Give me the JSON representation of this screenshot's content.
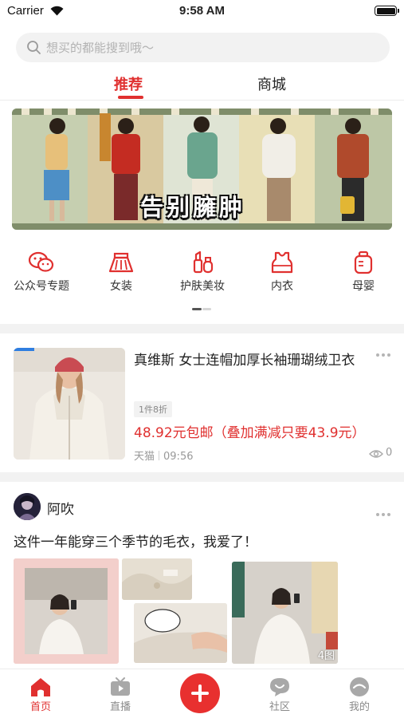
{
  "status_bar": {
    "carrier": "Carrier",
    "time": "9:58 AM"
  },
  "search": {
    "placeholder": "想买的都能搜到哦～"
  },
  "top_tabs": [
    {
      "label": "推荐",
      "active": true
    },
    {
      "label": "商城",
      "active": false
    }
  ],
  "banner": {
    "headline": "告别臃肿"
  },
  "categories": [
    {
      "label": "公众号专题",
      "icon": "wechat-icon"
    },
    {
      "label": "女装",
      "icon": "skirt-icon"
    },
    {
      "label": "护肤美妆",
      "icon": "cosmetics-icon"
    },
    {
      "label": "内衣",
      "icon": "vest-icon"
    },
    {
      "label": "母婴",
      "icon": "baby-bottle-icon"
    }
  ],
  "product": {
    "title": "真维斯 女士连帽加厚长袖珊瑚绒卫衣",
    "tag": "1件8折",
    "price": "48.92元包邮（叠加满减只要43.9元）",
    "source": "天猫",
    "time": "09:56",
    "views": "0"
  },
  "post": {
    "author": "阿吹",
    "text": "这件一年能穿三个季节的毛衣，我爱了！",
    "image_count": "4图"
  },
  "bottom_nav": [
    {
      "label": "首页",
      "icon": "home-icon",
      "active": true
    },
    {
      "label": "直播",
      "icon": "tv-icon",
      "active": false
    },
    {
      "label": "",
      "icon": "plus-icon",
      "active": false
    },
    {
      "label": "社区",
      "icon": "chat-bubble-icon",
      "active": false
    },
    {
      "label": "我的",
      "icon": "profile-icon",
      "active": false
    }
  ],
  "colors": {
    "accent": "#e0302f",
    "banner_green": "#c9d1b5"
  }
}
